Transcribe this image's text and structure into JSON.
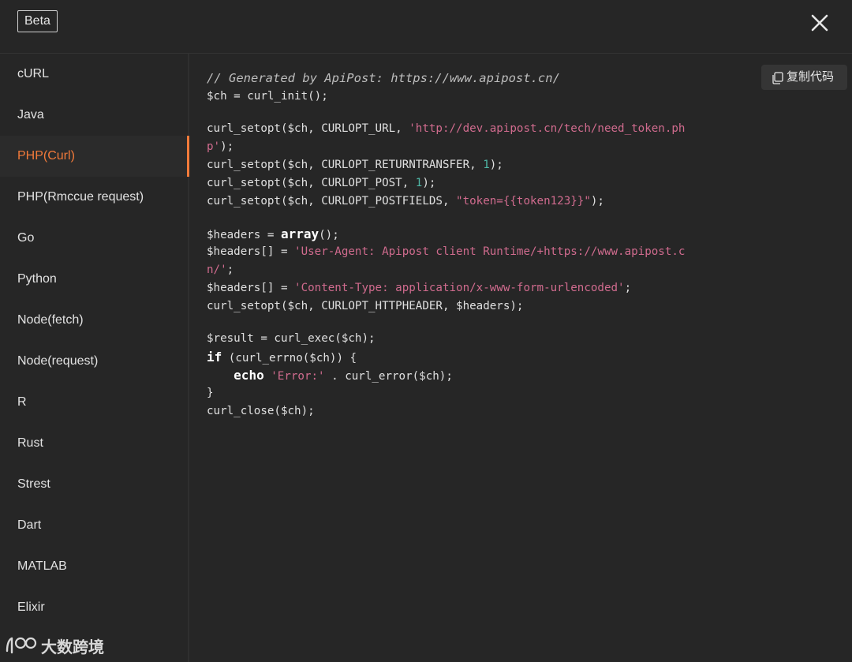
{
  "header": {
    "badge": "Beta",
    "close_icon": "close-icon"
  },
  "sidebar": {
    "selected_index": 2,
    "items": [
      {
        "label": "cURL"
      },
      {
        "label": "Java"
      },
      {
        "label": "PHP(Curl)"
      },
      {
        "label": "PHP(Rmccue request)"
      },
      {
        "label": "Go"
      },
      {
        "label": "Python"
      },
      {
        "label": "Node(fetch)"
      },
      {
        "label": "Node(request)"
      },
      {
        "label": "R"
      },
      {
        "label": "Rust"
      },
      {
        "label": "Strest"
      },
      {
        "label": "Dart"
      },
      {
        "label": "MATLAB"
      },
      {
        "label": "Elixir"
      }
    ]
  },
  "toolbar": {
    "copy_label": "复制代码",
    "copy_icon": "copy-icon"
  },
  "code": {
    "l01": "// Generated by ApiPost: https://www.apipost.cn/",
    "l02": "$ch = curl_init();",
    "l03a": "curl_setopt($ch, CURLOPT_URL, ",
    "l03b": "'http://dev.apipost.cn/tech/need_token.ph",
    "l04": "p'",
    "l04b": ");",
    "l05a": "curl_setopt($ch, CURLOPT_RETURNTRANSFER, ",
    "l05b": "1",
    "l05c": ");",
    "l06a": "curl_setopt($ch, CURLOPT_POST, ",
    "l06b": "1",
    "l06c": ");",
    "l07a": "curl_setopt($ch, CURLOPT_POSTFIELDS, ",
    "l07b": "\"token={{token123}}\"",
    "l07c": ");",
    "l08a": "$headers = ",
    "l08b": "array",
    "l08c": "();",
    "l09a": "$headers[] = ",
    "l09b": "'User-Agent: Apipost client Runtime/+https://www.apipost.c",
    "l10a": "n/'",
    "l10b": ";",
    "l11a": "$headers[] = ",
    "l11b": "'Content-Type: application/x-www-form-urlencoded'",
    "l11c": ";",
    "l12": "curl_setopt($ch, CURLOPT_HTTPHEADER, $headers);",
    "l13": "$result = curl_exec($ch);",
    "l14a": "if",
    "l14b": " (curl_errno($ch)) {",
    "l15a": "    ",
    "l15b": "echo",
    "l15c": " ",
    "l15d": "'Error:'",
    "l15e": " . curl_error($ch);",
    "l16": "}",
    "l17": "curl_close($ch);"
  },
  "watermark": {
    "text": "大数跨境",
    "logo_icon": "logo-icon"
  },
  "colors": {
    "accent": "#f27a3a",
    "string": "#d06b8e",
    "number": "#4fb7a6",
    "background": "#262626"
  }
}
